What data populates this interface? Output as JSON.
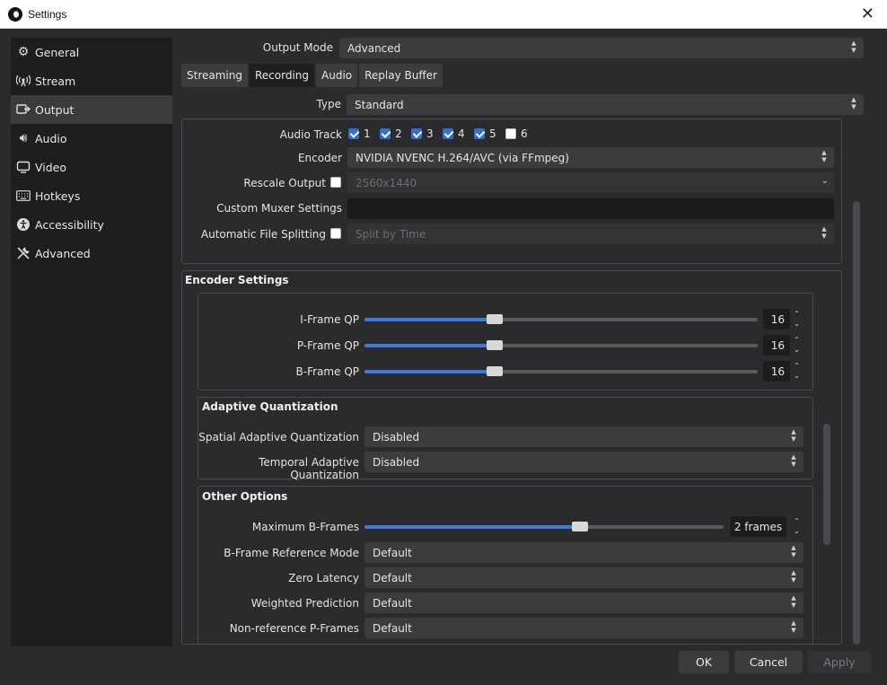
{
  "window": {
    "title": "Settings"
  },
  "sidebar": {
    "items": [
      {
        "label": "General",
        "icon": "gear-icon"
      },
      {
        "label": "Stream",
        "icon": "broadcast-icon"
      },
      {
        "label": "Output",
        "icon": "output-icon",
        "active": true
      },
      {
        "label": "Audio",
        "icon": "speaker-icon"
      },
      {
        "label": "Video",
        "icon": "monitor-icon"
      },
      {
        "label": "Hotkeys",
        "icon": "keyboard-icon"
      },
      {
        "label": "Accessibility",
        "icon": "accessibility-icon"
      },
      {
        "label": "Advanced",
        "icon": "tools-icon"
      }
    ]
  },
  "output_mode": {
    "label": "Output Mode",
    "value": "Advanced"
  },
  "tabs": [
    "Streaming",
    "Recording",
    "Audio",
    "Replay Buffer"
  ],
  "recording": {
    "type": {
      "label": "Type",
      "value": "Standard"
    },
    "audio_track": {
      "label": "Audio Track",
      "tracks": [
        {
          "n": "1",
          "checked": true
        },
        {
          "n": "2",
          "checked": true
        },
        {
          "n": "3",
          "checked": true
        },
        {
          "n": "4",
          "checked": true
        },
        {
          "n": "5",
          "checked": true
        },
        {
          "n": "6",
          "checked": false
        }
      ]
    },
    "encoder": {
      "label": "Encoder",
      "value": "NVIDIA NVENC H.264/AVC (via FFmpeg)"
    },
    "rescale": {
      "label": "Rescale Output",
      "value": "2560x1440"
    },
    "custom_muxer": {
      "label": "Custom Muxer Settings",
      "value": ""
    },
    "file_split": {
      "label": "Automatic File Splitting",
      "value": "Split by Time"
    }
  },
  "encoder_settings": {
    "title": "Encoder Settings",
    "qp": [
      {
        "label": "I-Frame QP",
        "value": "16",
        "fraction": 0.33
      },
      {
        "label": "P-Frame QP",
        "value": "16",
        "fraction": 0.33
      },
      {
        "label": "B-Frame QP",
        "value": "16",
        "fraction": 0.33
      }
    ],
    "adaptive": {
      "title": "Adaptive Quantization",
      "spatial": {
        "label": "Spatial Adaptive Quantization",
        "value": "Disabled"
      },
      "temporal": {
        "label": "Temporal Adaptive Quantization",
        "value": "Disabled"
      }
    },
    "other": {
      "title": "Other Options",
      "max_bframes": {
        "label": "Maximum B-Frames",
        "value": "2 frames",
        "fraction": 0.6
      },
      "bframe_ref": {
        "label": "B-Frame Reference Mode",
        "value": "Default"
      },
      "zero_latency": {
        "label": "Zero Latency",
        "value": "Default"
      },
      "weighted": {
        "label": "Weighted Prediction",
        "value": "Default"
      },
      "nonref": {
        "label": "Non-reference P-Frames",
        "value": "Default"
      }
    }
  },
  "buttons": {
    "ok": "OK",
    "cancel": "Cancel",
    "apply": "Apply"
  }
}
